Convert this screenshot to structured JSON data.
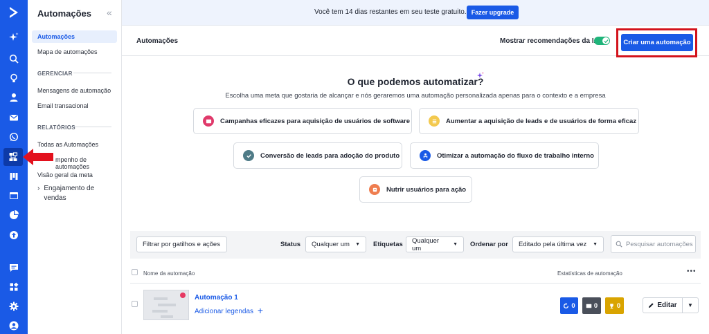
{
  "rail": {
    "icons": [
      "logo-icon",
      "sparkle-icon",
      "search-icon",
      "lightbulb-icon",
      "contacts-icon",
      "mail-icon",
      "whatsapp-icon",
      "automations-icon",
      "pipelines-icon",
      "website-icon",
      "reports-icon",
      "upgrade-icon",
      "conversations-icon",
      "apps-icon",
      "settings-icon",
      "user-avatar-icon"
    ],
    "brand_color": "#1a5ae6"
  },
  "sidebar": {
    "title": "Automações",
    "items": [
      {
        "label": "Automações",
        "active": true
      },
      {
        "label": "Mapa de automações"
      }
    ],
    "section_manage": "GERENCIAR",
    "manage_items": [
      {
        "label": "Mensagens de automação"
      },
      {
        "label": "Email transacional"
      }
    ],
    "section_reports": "RELATÓRIOS",
    "report_items": [
      {
        "label": "Todas as Automações"
      },
      {
        "label": "mpenho de automações"
      },
      {
        "label": "Visão geral da meta"
      }
    ],
    "sales_group": "Engajamento de vendas"
  },
  "banner": {
    "text": "Você tem 14 dias restantes em seu teste gratuito.",
    "upgrade_label": "Fazer upgrade"
  },
  "header": {
    "title": "Automações",
    "ai_toggle_label": "Mostrar recomendações da IA",
    "ai_toggle_on": true,
    "create_label": "Criar uma automação",
    "highlight_color": "#d3131c"
  },
  "ai": {
    "heading": "O que podemos automatizar?",
    "subtitle": "Escolha uma meta que gostaria de alcançar e nós geraremos uma automação personalizada apenas para o contexto e a empresa",
    "goals": [
      {
        "label": "Campanhas eficazes para aquisição de usuários de software",
        "color": "#e03a6b"
      },
      {
        "label": "Aumentar a aquisição de leads e de usuários de forma eficaz",
        "color": "#f3c94e"
      },
      {
        "label": "Conversão de leads para adoção do produto",
        "color": "#4f7b87"
      },
      {
        "label": "Otimizar a automação do fluxo de trabalho interno",
        "color": "#1a5ae6"
      },
      {
        "label": "Nutrir usuários para ação",
        "color": "#ef7d4f"
      }
    ]
  },
  "filters": {
    "trigger_button": "Filtrar por gatilhos e ações",
    "status_label": "Status",
    "status_value": "Qualquer um",
    "tags_label": "Etiquetas",
    "tags_value": "Qualquer um",
    "sort_label": "Ordenar por",
    "sort_value": "Editado pela última vez",
    "search_placeholder": "Pesquisar automações"
  },
  "table": {
    "col_name": "Nome da automação",
    "col_stats": "Estatísticas de automação",
    "more": "•••",
    "rows": [
      {
        "name": "Automação 1",
        "labels_link": "Adicionar legendas",
        "stats": [
          {
            "value": "0",
            "icon": "contacts-cycle-icon",
            "color": "#1a5ae6"
          },
          {
            "value": "0",
            "icon": "mail-icon",
            "color": "#4a4f5a"
          },
          {
            "value": "0",
            "icon": "goal-icon",
            "color": "#d9a400"
          }
        ],
        "edit_label": "Editar"
      }
    ]
  }
}
